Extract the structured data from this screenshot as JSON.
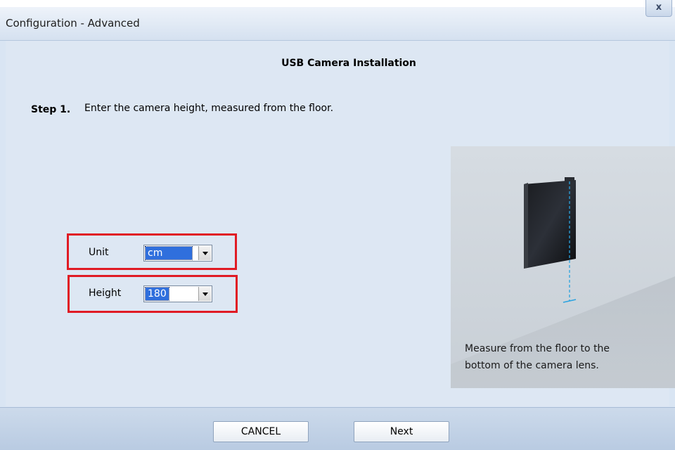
{
  "window": {
    "title": "Configuration - Advanced",
    "close_label": "x"
  },
  "heading": "USB Camera Installation",
  "step": {
    "label": "Step 1.",
    "text": "Enter the camera height, measured from the floor."
  },
  "form": {
    "unit": {
      "label": "Unit",
      "value": "cm"
    },
    "height": {
      "label": "Height",
      "value": "180"
    }
  },
  "illustration": {
    "caption_line1": "Measure from the floor to the",
    "caption_line2": "bottom of the camera lens."
  },
  "footer": {
    "cancel_label": "CANCEL",
    "next_label": "Next"
  },
  "colors": {
    "highlight_box": "#e01b24",
    "selection": "#2f6fdd",
    "background": "#dde7f3"
  }
}
